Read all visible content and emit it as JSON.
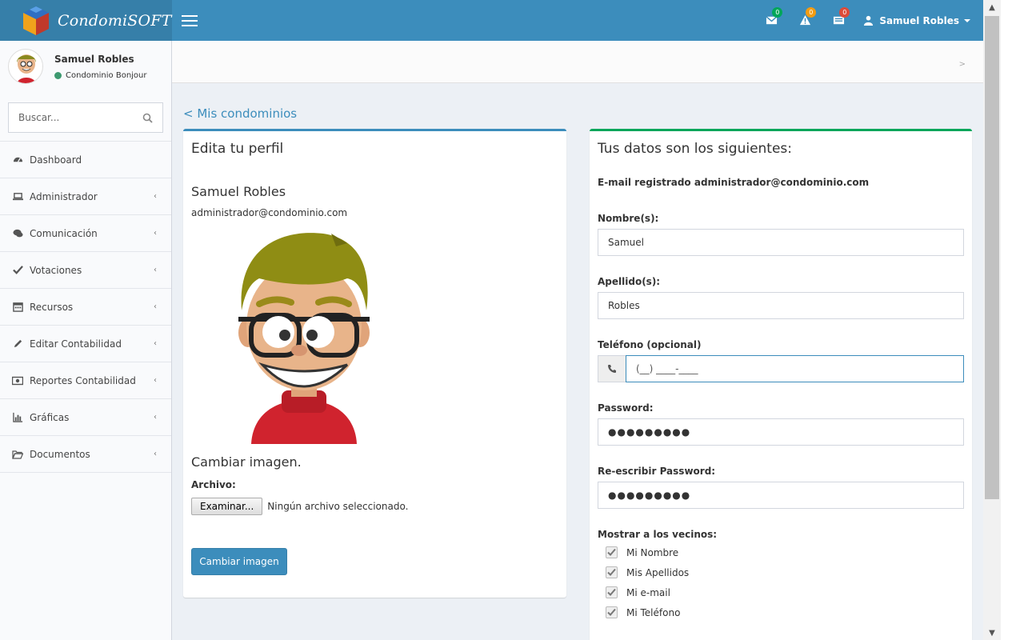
{
  "app": {
    "name": "CondomiSOFT"
  },
  "topbar": {
    "badges": {
      "messages": "0",
      "alerts": "0",
      "tasks": "0"
    },
    "user_name": "Samuel Robles"
  },
  "sidebar": {
    "user_name": "Samuel Robles",
    "user_status": "Condominio Bonjour",
    "search_placeholder": "Buscar...",
    "items": [
      {
        "label": "Dashboard",
        "icon": "dashboard-icon"
      },
      {
        "label": "Administrador",
        "icon": "laptop-icon"
      },
      {
        "label": "Comunicación",
        "icon": "comments-icon"
      },
      {
        "label": "Votaciones",
        "icon": "check-icon"
      },
      {
        "label": "Recursos",
        "icon": "calendar-icon"
      },
      {
        "label": "Editar Contabilidad",
        "icon": "pencil-icon"
      },
      {
        "label": "Reportes Contabilidad",
        "icon": "money-icon"
      },
      {
        "label": "Gráficas",
        "icon": "bar-chart-icon"
      },
      {
        "label": "Documentos",
        "icon": "folder-open-icon"
      }
    ]
  },
  "breadcrumb": {
    "separator": ">"
  },
  "back_link": "< Mis condominios",
  "profile_box": {
    "title": "Edita tu perfil",
    "name": "Samuel Robles",
    "email": "administrador@condominio.com",
    "change_image_title": "Cambiar imagen.",
    "file_label": "Archivo:",
    "file_button": "Examinar...",
    "file_status": "Ningún archivo seleccionado.",
    "submit_button": "Cambiar imagen"
  },
  "data_box": {
    "title": "Tus datos son los siguientes:",
    "email_line": "E-mail registrado administrador@condominio.com",
    "nombre_label": "Nombre(s):",
    "nombre_value": "Samuel",
    "apellido_label": "Apellido(s):",
    "apellido_value": "Robles",
    "telefono_label": "Teléfono (opcional)",
    "telefono_mask": "(__) ____-____",
    "password_label": "Password:",
    "password_value": "●●●●●●●●●",
    "repassword_label": "Re-escribir Password:",
    "repassword_value": "●●●●●●●●●",
    "mostrar_label": "Mostrar a los vecinos:",
    "checkboxes": [
      {
        "label": "Mi Nombre",
        "checked": true
      },
      {
        "label": "Mis Apellidos",
        "checked": true
      },
      {
        "label": "Mi e-mail",
        "checked": true
      },
      {
        "label": "Mi Teléfono",
        "checked": true
      }
    ]
  },
  "colors": {
    "topbar": "#3c8dbc",
    "logo_bg": "#367fa9",
    "primary": "#3c8dbc",
    "success": "#00a65a"
  }
}
